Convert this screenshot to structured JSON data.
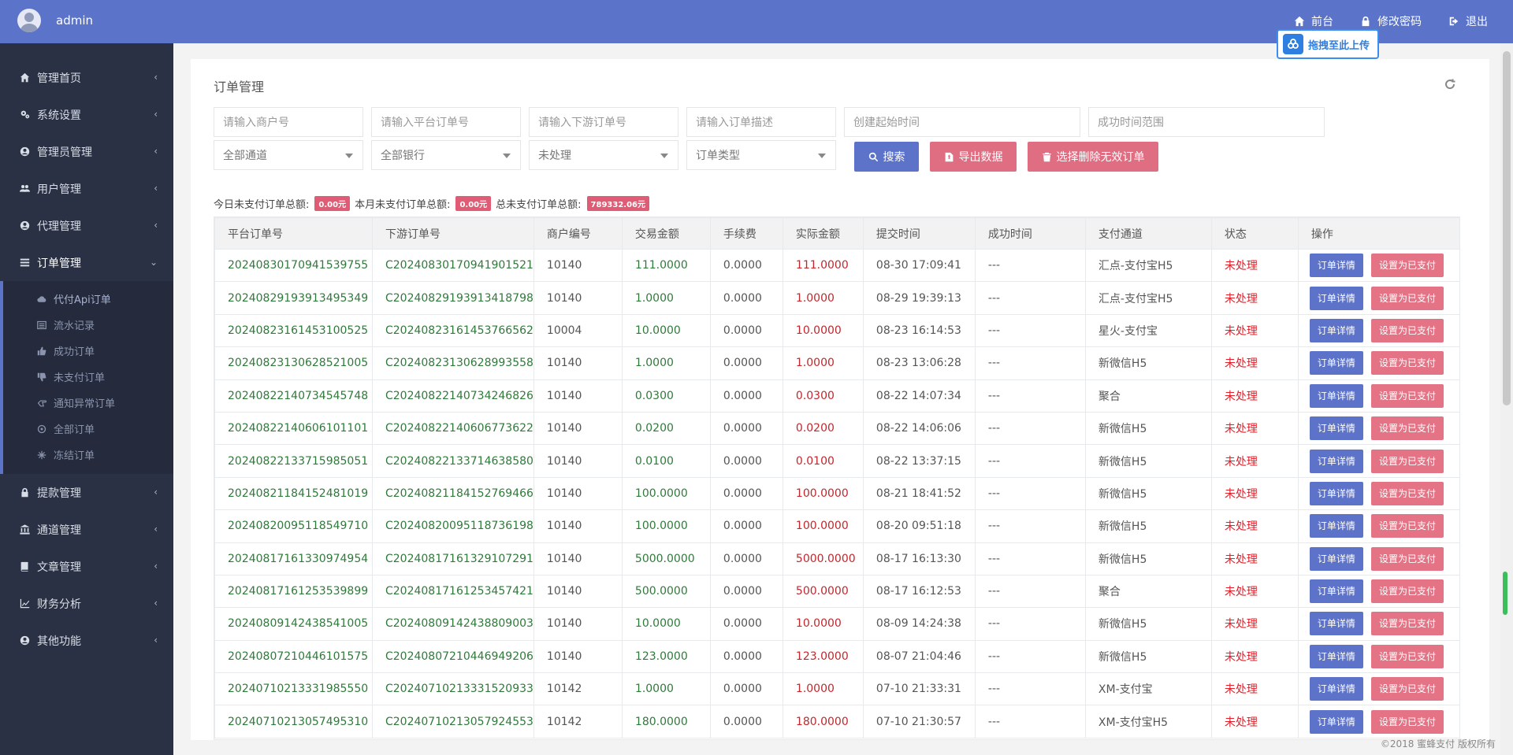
{
  "header": {
    "username": "admin",
    "nav": [
      {
        "label": "前台",
        "icon": "home-icon"
      },
      {
        "label": "修改密码",
        "icon": "lock-icon"
      },
      {
        "label": "退出",
        "icon": "logout-icon"
      }
    ],
    "upload_badge": "拖拽至此上传"
  },
  "sidebar": {
    "items": [
      {
        "label": "管理首页",
        "icon": "home-icon"
      },
      {
        "label": "系统设置",
        "icon": "gears-icon"
      },
      {
        "label": "管理员管理",
        "icon": "user-circle-icon"
      },
      {
        "label": "用户管理",
        "icon": "users-icon"
      },
      {
        "label": "代理管理",
        "icon": "user-circle-icon"
      },
      {
        "label": "订单管理",
        "icon": "list-icon"
      }
    ],
    "submenu": [
      {
        "label": "代付Api订单",
        "icon": "cloud-icon"
      },
      {
        "label": "流水记录",
        "icon": "list-alt-icon"
      },
      {
        "label": "成功订单",
        "icon": "thumbs-up-icon"
      },
      {
        "label": "未支付订单",
        "icon": "thumbs-down-icon"
      },
      {
        "label": "通知异常订单",
        "icon": "hand-icon"
      },
      {
        "label": "全部订单",
        "icon": "circle-icon"
      },
      {
        "label": "冻结订单",
        "icon": "snowflake-icon"
      }
    ],
    "items_after": [
      {
        "label": "提款管理",
        "icon": "lock-icon"
      },
      {
        "label": "通道管理",
        "icon": "bank-icon"
      },
      {
        "label": "文章管理",
        "icon": "book-icon"
      },
      {
        "label": "财务分析",
        "icon": "chart-icon"
      },
      {
        "label": "其他功能",
        "icon": "user-circle-icon"
      }
    ]
  },
  "page": {
    "title": "订单管理",
    "filters": {
      "merchant_placeholder": "请输入商户号",
      "platform_order_placeholder": "请输入平台订单号",
      "downstream_order_placeholder": "请输入下游订单号",
      "order_desc_placeholder": "请输入订单描述",
      "create_time_placeholder": "创建起始时间",
      "success_time_placeholder": "成功时间范围",
      "channel_select": "全部通道",
      "bank_select": "全部银行",
      "status_select": "未处理",
      "type_select": "订单类型"
    },
    "buttons": {
      "search": "搜索",
      "export": "导出数据",
      "delete_invalid": "选择删除无效订单"
    },
    "summary": {
      "today_label": "今日未支付订单总额:",
      "today_value": "0.00元",
      "month_label": "本月未支付订单总额:",
      "month_value": "0.00元",
      "total_label": "总未支付订单总额:",
      "total_value": "789332.06元"
    }
  },
  "table": {
    "columns": [
      "平台订单号",
      "下游订单号",
      "商户编号",
      "交易金额",
      "手续费",
      "实际金额",
      "提交时间",
      "成功时间",
      "支付通道",
      "状态",
      "操作"
    ],
    "detail_btn": "订单详情",
    "paid_btn": "设置为已支付",
    "rows": [
      [
        "20240830170941539755",
        "C20240830170941901521",
        "10140",
        "111.0000",
        "0.0000",
        "111.0000",
        "08-30 17:09:41",
        "---",
        "汇点-支付宝H5",
        "未处理"
      ],
      [
        "20240829193913495349",
        "C20240829193913418798",
        "10140",
        "1.0000",
        "0.0000",
        "1.0000",
        "08-29 19:39:13",
        "---",
        "汇点-支付宝H5",
        "未处理"
      ],
      [
        "20240823161453100525",
        "C20240823161453766562",
        "10004",
        "10.0000",
        "0.0000",
        "10.0000",
        "08-23 16:14:53",
        "---",
        "星火-支付宝",
        "未处理"
      ],
      [
        "20240823130628521005",
        "C20240823130628993558",
        "10140",
        "1.0000",
        "0.0000",
        "1.0000",
        "08-23 13:06:28",
        "---",
        "新微信H5",
        "未处理"
      ],
      [
        "20240822140734545748",
        "C20240822140734246826",
        "10140",
        "0.0300",
        "0.0000",
        "0.0300",
        "08-22 14:07:34",
        "---",
        "聚合",
        "未处理"
      ],
      [
        "20240822140606101101",
        "C20240822140606773622",
        "10140",
        "0.0200",
        "0.0000",
        "0.0200",
        "08-22 14:06:06",
        "---",
        "新微信H5",
        "未处理"
      ],
      [
        "20240822133715985051",
        "C20240822133714638580",
        "10140",
        "0.0100",
        "0.0000",
        "0.0100",
        "08-22 13:37:15",
        "---",
        "新微信H5",
        "未处理"
      ],
      [
        "20240821184152481019",
        "C20240821184152769466",
        "10140",
        "100.0000",
        "0.0000",
        "100.0000",
        "08-21 18:41:52",
        "---",
        "新微信H5",
        "未处理"
      ],
      [
        "20240820095118549710",
        "C20240820095118736198",
        "10140",
        "100.0000",
        "0.0000",
        "100.0000",
        "08-20 09:51:18",
        "---",
        "新微信H5",
        "未处理"
      ],
      [
        "20240817161330974954",
        "C20240817161329107291",
        "10140",
        "5000.0000",
        "0.0000",
        "5000.0000",
        "08-17 16:13:30",
        "---",
        "新微信H5",
        "未处理"
      ],
      [
        "20240817161253539899",
        "C20240817161253457421",
        "10140",
        "500.0000",
        "0.0000",
        "500.0000",
        "08-17 16:12:53",
        "---",
        "聚合",
        "未处理"
      ],
      [
        "20240809142438541005",
        "C20240809142438809003",
        "10140",
        "10.0000",
        "0.0000",
        "10.0000",
        "08-09 14:24:38",
        "---",
        "新微信H5",
        "未处理"
      ],
      [
        "20240807210446101575",
        "C20240807210446949206",
        "10140",
        "123.0000",
        "0.0000",
        "123.0000",
        "08-07 21:04:46",
        "---",
        "新微信H5",
        "未处理"
      ],
      [
        "20240710213331985550",
        "C20240710213331520933",
        "10142",
        "1.0000",
        "0.0000",
        "1.0000",
        "07-10 21:33:31",
        "---",
        "XM-支付宝",
        "未处理"
      ],
      [
        "20240710213057495310",
        "C20240710213057924553",
        "10142",
        "180.0000",
        "0.0000",
        "180.0000",
        "07-10 21:30:57",
        "---",
        "XM-支付宝H5",
        "未处理"
      ]
    ]
  },
  "footer": "©2018 蜜蜂支付 版权所有",
  "colors": {
    "header": "#5b74c9",
    "sidebar": "#2a3144",
    "button_blue": "#5d72c9",
    "button_red": "#e06e82",
    "status_red": "#e0202a"
  }
}
